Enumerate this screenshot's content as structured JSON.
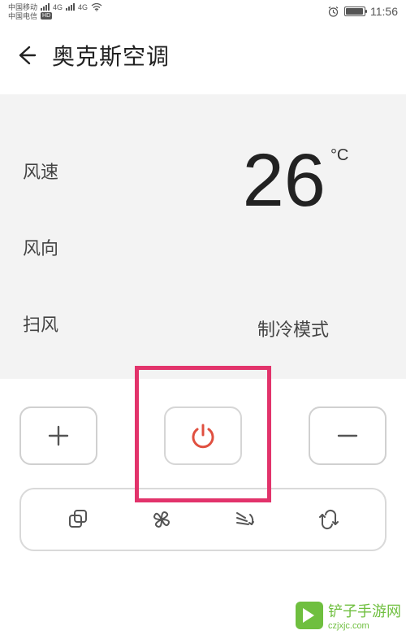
{
  "statusbar": {
    "carrier1": "中国移动",
    "carrier2": "中国电信",
    "net1": "4G",
    "net2": "4G",
    "hd": "HD",
    "time": "11:56"
  },
  "header": {
    "title": "奥克斯空调"
  },
  "settings": {
    "wind_speed_label": "风速",
    "wind_direction_label": "风向",
    "sweep_label": "扫风"
  },
  "display": {
    "temperature": "26",
    "unit": "°C",
    "mode": "制冷模式"
  },
  "icons": {
    "back": "back-arrow",
    "plus": "plus",
    "minus": "minus",
    "power": "power",
    "tool_copy": "copy",
    "tool_fan": "fan",
    "tool_swing": "swing",
    "tool_cycle": "cycle"
  },
  "colors": {
    "highlight": "#e2336b",
    "power": "#e05040",
    "watermark": "#6fbf3f"
  },
  "watermark": {
    "brand": "铲子手游网",
    "url": "czjxjc.com"
  }
}
